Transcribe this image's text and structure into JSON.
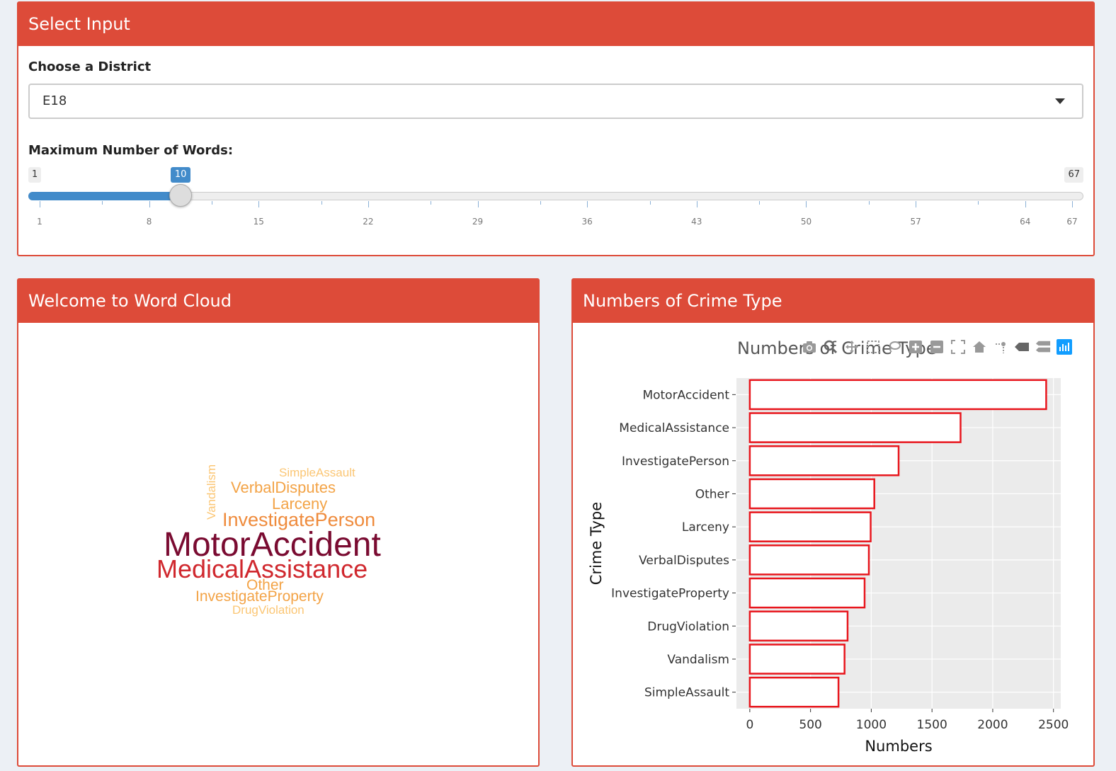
{
  "select_box": {
    "title": "Select Input",
    "district_label": "Choose a District",
    "district_value": "E18",
    "words_label": "Maximum Number of Words:",
    "slider": {
      "min": 1,
      "max": 67,
      "value": 10,
      "min_label": "1",
      "max_label": "67",
      "value_label": "10",
      "ticks": [
        "1",
        "8",
        "15",
        "22",
        "29",
        "36",
        "43",
        "50",
        "57",
        "64",
        "67"
      ]
    }
  },
  "cloud_box": {
    "title": "Welcome to Word Cloud",
    "words": [
      {
        "text": "MotorAccident",
        "color": "#7a0b31"
      },
      {
        "text": "MedicalAssistance",
        "color": "#d0282e"
      },
      {
        "text": "InvestigatePerson",
        "color": "#ef8b3c"
      },
      {
        "text": "Larceny",
        "color": "#f3a346"
      },
      {
        "text": "VerbalDisputes",
        "color": "#f3a346"
      },
      {
        "text": "SimpleAssault",
        "color": "#fbc674"
      },
      {
        "text": "Vandalism",
        "color": "#fbc674"
      },
      {
        "text": "Other",
        "color": "#f3a346"
      },
      {
        "text": "InvestigateProperty",
        "color": "#f3a346"
      },
      {
        "text": "DrugViolation",
        "color": "#fbc674"
      }
    ]
  },
  "crime_box": {
    "title": "Numbers of Crime Type",
    "toolbar_icons": [
      "camera-icon",
      "zoom-icon",
      "pan-icon",
      "box-select-icon",
      "lasso-icon",
      "zoom-in-icon",
      "zoom-out-icon",
      "autoscale-icon",
      "home-icon",
      "spike-lines-icon",
      "hover-closest-icon",
      "hover-compare-icon",
      "plotly-logo-icon"
    ]
  },
  "chart_data": {
    "type": "bar",
    "orientation": "horizontal",
    "title": "Numbers of Crime Type",
    "xlabel": "Numbers",
    "ylabel": "Crime Type",
    "categories": [
      "MotorAccident",
      "MedicalAssistance",
      "InvestigatePerson",
      "Other",
      "Larceny",
      "VerbalDisputes",
      "InvestigateProperty",
      "DrugViolation",
      "Vandalism",
      "SimpleAssault"
    ],
    "values": [
      2440,
      1735,
      1225,
      1025,
      995,
      980,
      945,
      805,
      780,
      730
    ],
    "xlim": [
      -110,
      2560
    ],
    "xticks": [
      0,
      500,
      1000,
      1500,
      2000,
      2500
    ],
    "bar_fill": "#ffffff",
    "bar_edge": "#e8161d",
    "panel_bg": "#ebebeb",
    "grid": true
  }
}
